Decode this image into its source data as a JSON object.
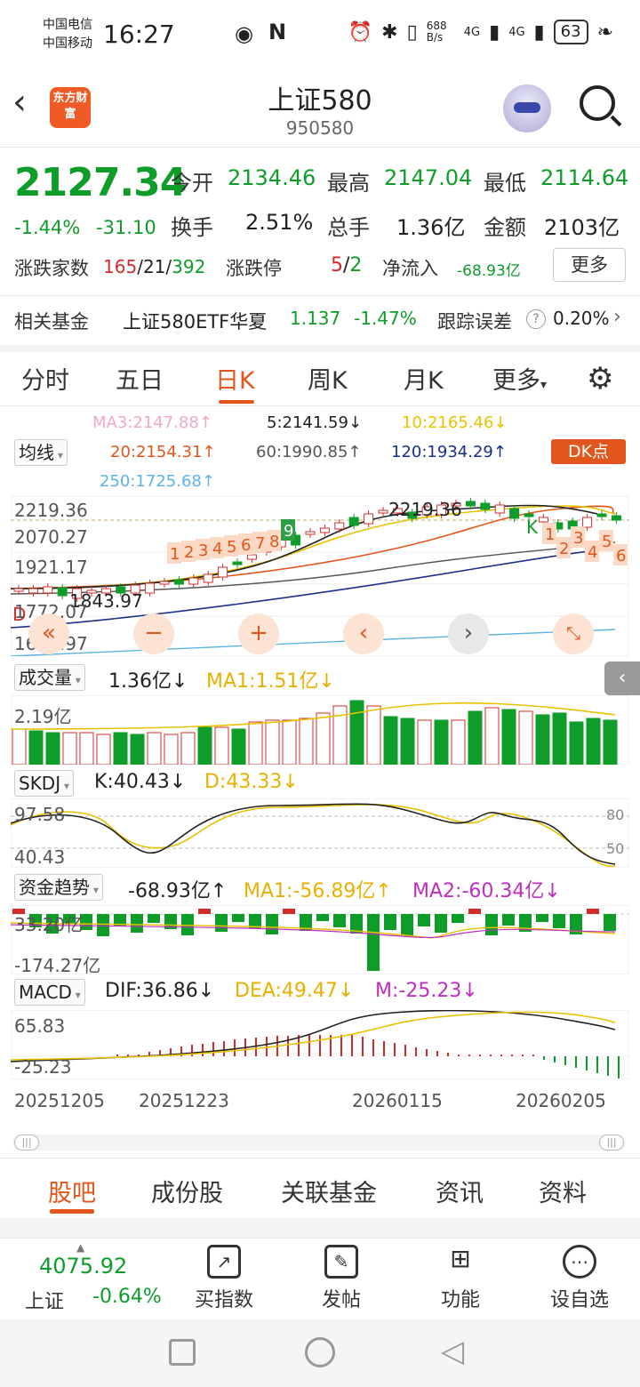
{
  "status_bar": {
    "carrier1": "中国电信",
    "carrier2": "中国移动",
    "time": "16:27",
    "net_speed": "688 B/s",
    "signal1": "4G",
    "signal2": "4G",
    "battery": "63"
  },
  "header": {
    "logo": "东方财富",
    "title": "上证580",
    "code": "950580"
  },
  "quote": {
    "price": "2127.34",
    "change_pct": "-1.44%",
    "change": "-31.10",
    "open_label": "今开",
    "open": "2134.46",
    "high_label": "最高",
    "high": "2147.04",
    "low_label": "最低",
    "low": "2114.64",
    "turnover_label": "换手",
    "turnover": "2.51%",
    "volume_label": "总手",
    "volume": "1.36亿",
    "amount_label": "金额",
    "amount": "2103亿",
    "breadth_label": "涨跌家数",
    "up": "165",
    "flat": "21",
    "down": "392",
    "limit_label": "涨跌停",
    "limit_up": "5",
    "limit_down": "2",
    "netflow_label": "净流入",
    "netflow": "-68.93亿",
    "more": "更多"
  },
  "fund": {
    "label": "相关基金",
    "name": "上证580ETF华夏",
    "price": "1.137",
    "change": "-1.47%",
    "tracking_label": "跟踪误差",
    "tracking": "0.20%"
  },
  "kline_tabs": [
    "分时",
    "五日",
    "日K",
    "周K",
    "月K",
    "更多"
  ],
  "ma_legend": {
    "selector": "均线",
    "ma3": "MA3:2147.88↑",
    "ma5": "5:2141.59↓",
    "ma10": "10:2165.46↓",
    "ma20": "20:2154.31↑",
    "ma60": "60:1990.85↑",
    "ma120": "120:1934.29↑",
    "ma250": "250:1725.68↑",
    "dk_button": "DK点"
  },
  "price_axis": [
    "2219.36",
    "2070.27",
    "1921.17",
    "1772.07",
    "1622.97"
  ],
  "annotations": {
    "high_mark": "2219.36",
    "low_mark": "1843.97",
    "k_mark": "K",
    "d_mark": "D",
    "seq1": [
      "1",
      "2",
      "3",
      "4",
      "5",
      "6",
      "7",
      "8",
      "9"
    ],
    "seq2": [
      "1",
      "2",
      "3",
      "4",
      "5",
      "6"
    ]
  },
  "volume": {
    "selector": "成交量",
    "value": "1.36亿↓",
    "ma1": "MA1:1.51亿↓",
    "axis": "2.19亿"
  },
  "skdj": {
    "selector": "SKDJ",
    "k": "K:40.43↓",
    "d": "D:43.33↓",
    "axis_top": "97.58",
    "axis_bottom": "40.43",
    "level_high": "80",
    "level_low": "50"
  },
  "fund_trend": {
    "selector": "资金趋势",
    "value": "-68.93亿↑",
    "ma1": "MA1:-56.89亿↑",
    "ma2": "MA2:-60.34亿↓",
    "axis_top": "33.20亿",
    "axis_bottom": "-174.27亿"
  },
  "macd": {
    "selector": "MACD",
    "dif": "DIF:36.86↓",
    "dea": "DEA:49.47↓",
    "m": "M:-25.23↓",
    "axis_top": "65.83",
    "axis_bottom": "-25.23"
  },
  "dates": [
    "20251205",
    "20251223",
    "20260115",
    "20260205"
  ],
  "bottom_tabs": [
    "股吧",
    "成份股",
    "关联基金",
    "资讯",
    "资料"
  ],
  "dock": {
    "index_value": "4075.92",
    "index_name": "上证",
    "index_change": "-0.64%",
    "items": [
      "买指数",
      "发帖",
      "功能",
      "设自选"
    ]
  },
  "colors": {
    "accent": "#e2561b",
    "up": "#d12c2c",
    "down": "#0f9d2a"
  }
}
